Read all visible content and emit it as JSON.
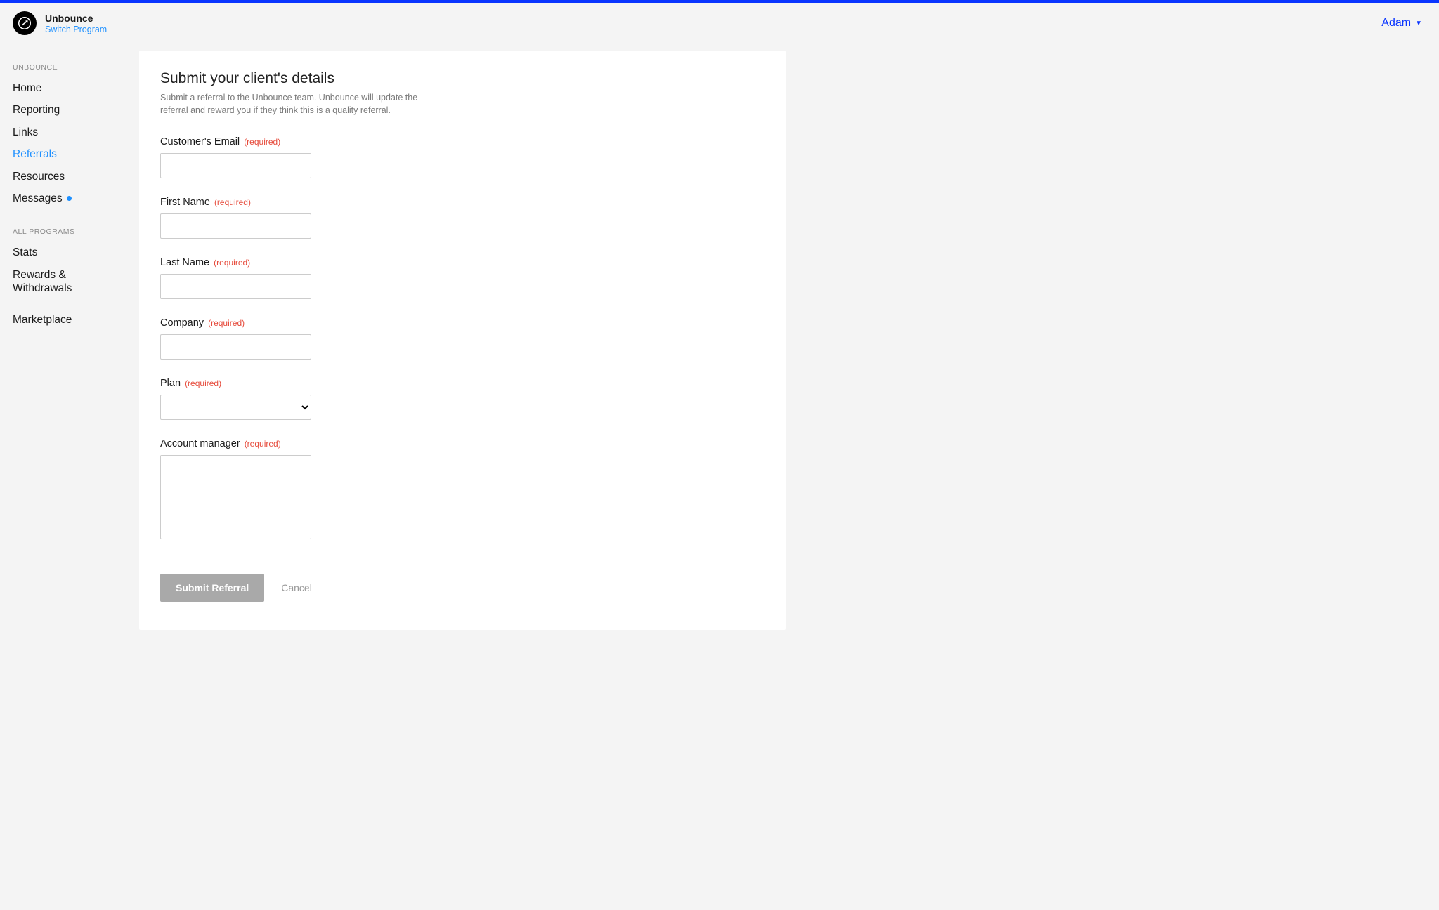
{
  "colors": {
    "accent": "#0a35ff",
    "link": "#1e90ff",
    "danger": "#e64b3c",
    "bg": "#f4f4f4"
  },
  "header": {
    "brand_name": "Unbounce",
    "subtitle": "Switch Program",
    "user_name": "Adam"
  },
  "sidebar": {
    "section1": "UNBOUNCE",
    "items1": [
      {
        "label": "Home",
        "active": false,
        "dot": false
      },
      {
        "label": "Reporting",
        "active": false,
        "dot": false
      },
      {
        "label": "Links",
        "active": false,
        "dot": false
      },
      {
        "label": "Referrals",
        "active": true,
        "dot": false
      },
      {
        "label": "Resources",
        "active": false,
        "dot": false
      },
      {
        "label": "Messages",
        "active": false,
        "dot": true
      }
    ],
    "section2": "ALL PROGRAMS",
    "items2": [
      {
        "label": "Stats"
      },
      {
        "label": "Rewards & Withdrawals"
      }
    ],
    "items3": [
      {
        "label": "Marketplace"
      }
    ]
  },
  "main": {
    "title": "Submit your client's details",
    "description": "Submit a referral to the Unbounce team. Unbounce will update the referral and reward you if they think this is a quality referral.",
    "required_tag": "(required)",
    "fields": {
      "email": {
        "label": "Customer's Email",
        "value": ""
      },
      "first": {
        "label": "First Name",
        "value": ""
      },
      "last": {
        "label": "Last Name",
        "value": ""
      },
      "company": {
        "label": "Company",
        "value": ""
      },
      "plan": {
        "label": "Plan",
        "value": "",
        "options": [
          ""
        ]
      },
      "manager": {
        "label": "Account manager",
        "value": ""
      }
    },
    "submit_label": "Submit Referral",
    "cancel_label": "Cancel"
  }
}
